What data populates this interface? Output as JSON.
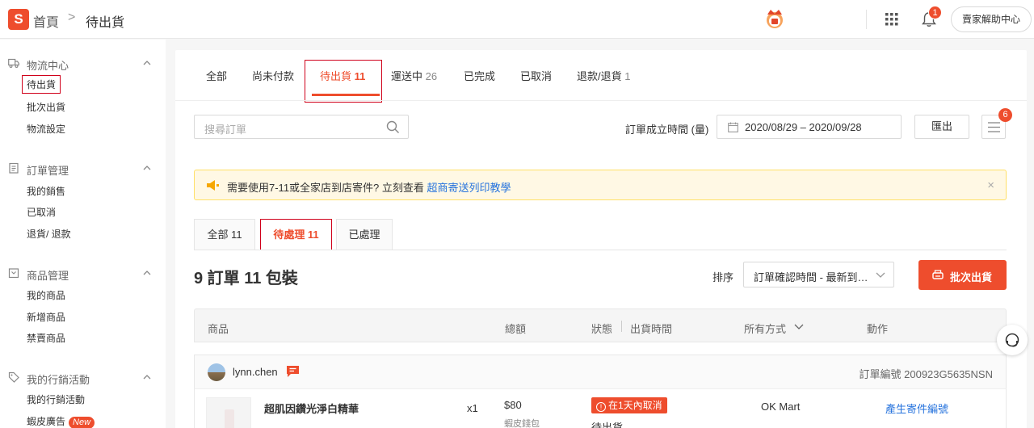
{
  "header": {
    "breadcrumb_home": "首頁",
    "breadcrumb_sep": ">",
    "breadcrumb_current": "待出貨",
    "notification_count": "1",
    "help_label": "賣家解助中心",
    "accent": "#ee4d2d"
  },
  "sidebar": {
    "sections": [
      {
        "title": "物流中心",
        "icon": "truck-icon",
        "items": [
          "待出貨",
          "批次出貨",
          "物流設定"
        ]
      },
      {
        "title": "訂單管理",
        "icon": "clipboard-icon",
        "items": [
          "我的銷售",
          "已取消",
          "退貨/ 退款"
        ]
      },
      {
        "title": "商品管理",
        "icon": "box-icon",
        "items": [
          "我的商品",
          "新增商品",
          "禁賣商品"
        ]
      },
      {
        "title": "我的行銷活動",
        "icon": "tag-icon",
        "items": [
          "我的行銷活動",
          "蝦皮廣告"
        ]
      }
    ],
    "new_badge": "New"
  },
  "tabs": [
    {
      "label": "全部",
      "count": ""
    },
    {
      "label": "尚未付款",
      "count": ""
    },
    {
      "label": "待出貨",
      "count": "11"
    },
    {
      "label": "運送中",
      "count": "26"
    },
    {
      "label": "已完成",
      "count": ""
    },
    {
      "label": "已取消",
      "count": ""
    },
    {
      "label": "退款/退貨",
      "count": "1"
    }
  ],
  "toolbar": {
    "search_placeholder": "搜尋訂單",
    "date_label": "訂單成立時間 (量)",
    "date_range": "2020/08/29 – 2020/09/28",
    "export_label": "匯出",
    "list_badge": "6"
  },
  "notice": {
    "text": "需要使用7-11或全家店到店寄件? 立刻查看",
    "link": "超商寄送列印教學",
    "close": "×"
  },
  "subtabs": [
    {
      "label": "全部 11"
    },
    {
      "label": "待處理 11"
    },
    {
      "label": "已處理"
    }
  ],
  "summary": "9 訂單 11 包裝",
  "sort": {
    "label": "排序",
    "value": "訂單確認時間 - 最新到…"
  },
  "batch_label": "批次出貨",
  "table": {
    "headers": {
      "product": "商品",
      "total": "總額",
      "status": "狀態",
      "ship_time": "出貨時間",
      "ship_method": "所有方式",
      "action": "動作"
    }
  },
  "order": {
    "username": "lynn.chen",
    "order_no": "訂單編號 200923G5635NSN",
    "product_name": "超肌因鑽光淨白精華",
    "qty": "x1",
    "price": "$80",
    "payment": "蝦皮錢包",
    "cancel_pill": "在1天內取消",
    "status": "待出貨",
    "ship_method": "OK Mart",
    "action": "產生寄件編號"
  }
}
